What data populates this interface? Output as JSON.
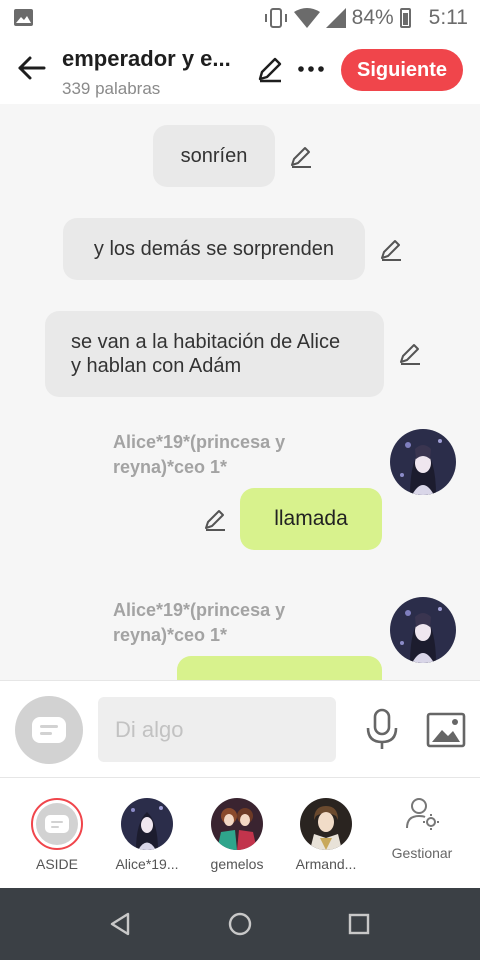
{
  "status_bar": {
    "battery": "84%",
    "time": "5:11"
  },
  "header": {
    "title": "emperador y e...",
    "word_count": "339 palabras",
    "next_label": "Siguiente"
  },
  "messages": {
    "m1": "sonríen",
    "m2": "y los demás se sorprenden",
    "m3_line1": "se van a la habitación de Alice",
    "m3_line2": "y hablan con Adám",
    "m4_sender_line1": "Alice*19*(princesa y",
    "m4_sender_line2": "reyna)*ceo 1*",
    "m4_text": "llamada",
    "m5_sender_line1": "Alice*19*(princesa y",
    "m5_sender_line2": "reyna)*ceo 1*"
  },
  "composer": {
    "placeholder": "Di algo"
  },
  "characters": {
    "aside": "ASIDE",
    "alice": "Alice*19...",
    "gemelos": "gemelos",
    "armando": "Armand...",
    "manage": "Gestionar"
  },
  "colors": {
    "accent": "#f0454b",
    "bubble_green": "#d8f28d",
    "bubble_gray": "#e9e9e9",
    "nav_bar": "#3b4045"
  }
}
